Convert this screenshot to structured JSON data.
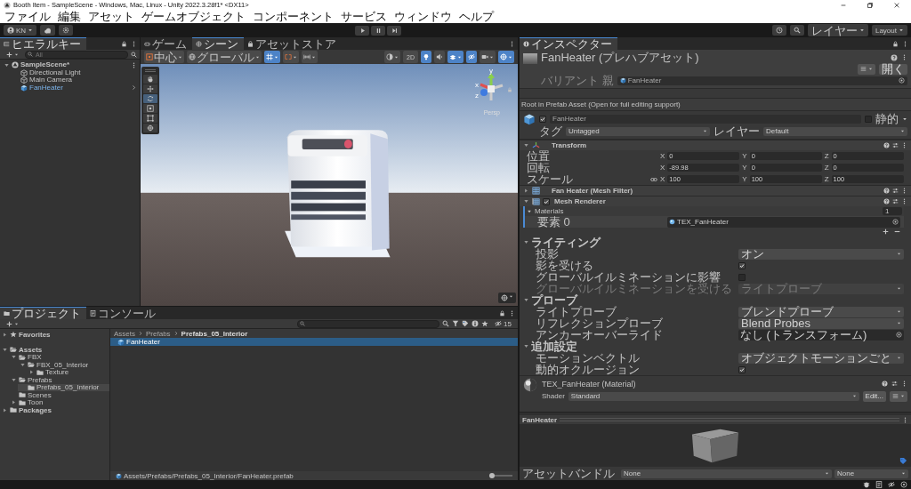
{
  "window": {
    "title": "Booth Item - SampleScene - Windows, Mac, Linux - Unity 2022.3.28f1* <DX11>"
  },
  "menu": [
    "ファイル",
    "編集",
    "アセット",
    "ゲームオブジェクト",
    "コンポーネント",
    "サービス",
    "ウィンドウ",
    "ヘルプ"
  ],
  "toolbar": {
    "account": "KN",
    "layers": "レイヤー",
    "layout": "Layout"
  },
  "hierarchy": {
    "tab": "ヒエラルキー",
    "search": {
      "placeholder": "All"
    },
    "items": [
      {
        "label": "SampleScene*",
        "kind": "scene",
        "expanded": true,
        "children": [
          {
            "label": "Directional Light",
            "kind": "object"
          },
          {
            "label": "Main Camera",
            "kind": "object"
          },
          {
            "label": "FanHeater",
            "kind": "prefab"
          }
        ]
      }
    ]
  },
  "scene_view": {
    "tabs": [
      {
        "label": "ゲーム",
        "kind": "game",
        "selected": false
      },
      {
        "label": "シーン",
        "kind": "scene",
        "selected": true
      },
      {
        "label": "アセットストア",
        "kind": "store",
        "selected": false
      }
    ],
    "pivot": "中心",
    "space": "グローバル",
    "snap_toggles": [
      {
        "kind": "grid",
        "on": true
      },
      {
        "kind": "snap",
        "on": false
      },
      {
        "kind": "increment",
        "on": false
      }
    ],
    "mode_2d": {
      "label": "2D",
      "on": false
    },
    "view_toggles": [
      {
        "kind": "lighting",
        "on": true
      },
      {
        "kind": "audio",
        "on": false
      },
      {
        "kind": "effects",
        "on": true
      },
      {
        "kind": "visibility",
        "on": true
      },
      {
        "kind": "camera",
        "on": false
      },
      {
        "kind": "gizmos",
        "on": true
      }
    ],
    "tools": [
      {
        "kind": "hand",
        "selected": false
      },
      {
        "kind": "move",
        "selected": false
      },
      {
        "kind": "rotate",
        "selected": true
      },
      {
        "kind": "scale",
        "selected": false
      },
      {
        "kind": "rect",
        "selected": false
      },
      {
        "kind": "transform",
        "selected": false
      }
    ],
    "axes": [
      "y",
      "x",
      "z"
    ],
    "projection": "Persp"
  },
  "inspector": {
    "tab": "インスペクター",
    "asset_title": "FanHeater (プレハブアセット)",
    "open_button": "開く",
    "variant_label": "バリアント 親",
    "variant_value": "FanHeater",
    "notice": "Root in Prefab Asset (Open for full editing support)",
    "object": {
      "name": "FanHeater",
      "active": true,
      "static_label": "静的",
      "static": false,
      "tag_label": "タグ",
      "tag": "Untagged",
      "layer_label": "レイヤー",
      "layer": "Default"
    },
    "transform": {
      "title": "Transform",
      "expanded": true,
      "rows": [
        {
          "label": "位置",
          "kind": "vector",
          "values": [
            {
              "axis": "X",
              "value": "0"
            },
            {
              "axis": "Y",
              "value": "0"
            },
            {
              "axis": "Z",
              "value": "0"
            }
          ]
        },
        {
          "label": "回転",
          "kind": "vector",
          "values": [
            {
              "axis": "X",
              "value": "-89.98"
            },
            {
              "axis": "Y",
              "value": "0"
            },
            {
              "axis": "Z",
              "value": "0"
            }
          ]
        },
        {
          "label": "スケール",
          "kind": "scale",
          "values": [
            {
              "axis": "X",
              "value": "100"
            },
            {
              "axis": "Y",
              "value": "100"
            },
            {
              "axis": "Z",
              "value": "100"
            }
          ]
        }
      ]
    },
    "mesh_filter": {
      "title": "Fan Heater (Mesh Filter)",
      "expanded": false
    },
    "mesh_renderer": {
      "title": "Mesh Renderer",
      "expanded": true,
      "enabled": true,
      "materials": {
        "label": "Materials",
        "expanded": true,
        "count": "1",
        "items": [
          {
            "label": "要素 0",
            "value": "TEX_FanHeater"
          }
        ]
      },
      "sections": [
        {
          "title": "ライティング",
          "expanded": true,
          "rows": [
            {
              "label": "投影",
              "kind": "dropdown",
              "value": "オン",
              "disabled": false
            },
            {
              "label": "影を受ける",
              "kind": "checkbox",
              "checked": true,
              "disabled": false
            },
            {
              "label": "グローバルイルミネーションに影響",
              "kind": "checkbox",
              "checked": false,
              "disabled": false
            },
            {
              "label": "グローバルイルミネーションを受ける",
              "kind": "dropdown",
              "value": "ライトプローブ",
              "disabled": true
            }
          ]
        },
        {
          "title": "プローブ",
          "expanded": true,
          "rows": [
            {
              "label": "ライトプローブ",
              "kind": "dropdown",
              "value": "ブレンドプローブ",
              "disabled": false
            },
            {
              "label": "リフレクションプローブ",
              "kind": "dropdown",
              "value": "Blend Probes",
              "disabled": false
            },
            {
              "label": "アンカーオーバーライド",
              "kind": "object",
              "value": "なし (トランスフォーム)",
              "disabled": false
            }
          ]
        },
        {
          "title": "追加設定",
          "expanded": true,
          "rows": [
            {
              "label": "モーションベクトル",
              "kind": "dropdown",
              "value": "オブジェクトモーションごと",
              "disabled": false
            },
            {
              "label": "動的オクルージョン",
              "kind": "checkbox",
              "checked": true,
              "disabled": false
            }
          ]
        }
      ]
    },
    "material": {
      "title": "TEX_FanHeater (Material)",
      "shader_label": "Shader",
      "shader": "Standard",
      "edit_button": "Edit..."
    },
    "preview": {
      "title": "FanHeater"
    },
    "asset_bundle": {
      "label": "アセットバンドル",
      "name": "None",
      "variant": "None"
    }
  },
  "project": {
    "tabs": [
      {
        "label": "プロジェクト",
        "kind": "project",
        "selected": true
      },
      {
        "label": "コンソール",
        "kind": "console",
        "selected": false
      }
    ],
    "hidden_count": "15",
    "tree": [
      {
        "label": "Favorites",
        "kind": "favorites",
        "expanded": false,
        "selected": false
      },
      {
        "label": "Assets",
        "kind": "root",
        "expanded": true,
        "selected": false,
        "children": [
          {
            "label": "FBX",
            "kind": "folder",
            "expanded": true,
            "selected": false,
            "children": [
              {
                "label": "FBX_05_Interior",
                "kind": "folder",
                "expanded": true,
                "selected": false,
                "children": [
                  {
                    "label": "Texture",
                    "kind": "folder",
                    "expanded": false,
                    "selected": false
                  }
                ]
              }
            ]
          },
          {
            "label": "Prefabs",
            "kind": "folder",
            "expanded": true,
            "selected": false,
            "children": [
              {
                "label": "Prefabs_05_Interior",
                "kind": "folder",
                "selected": true
              }
            ]
          },
          {
            "label": "Scenes",
            "kind": "folder",
            "selected": false
          },
          {
            "label": "Toon",
            "kind": "folder",
            "expanded": false,
            "selected": false
          }
        ]
      },
      {
        "label": "Packages",
        "kind": "root",
        "expanded": false,
        "selected": false
      }
    ],
    "breadcrumb": [
      "Assets",
      "Prefabs",
      "Prefabs_05_Interior"
    ],
    "files": [
      {
        "label": "FanHeater",
        "selected": true
      }
    ],
    "path": "Assets/Prefabs/Prefabs_05_Interior/FanHeater.prefab",
    "zoom_slider": {
      "level": 0
    }
  }
}
